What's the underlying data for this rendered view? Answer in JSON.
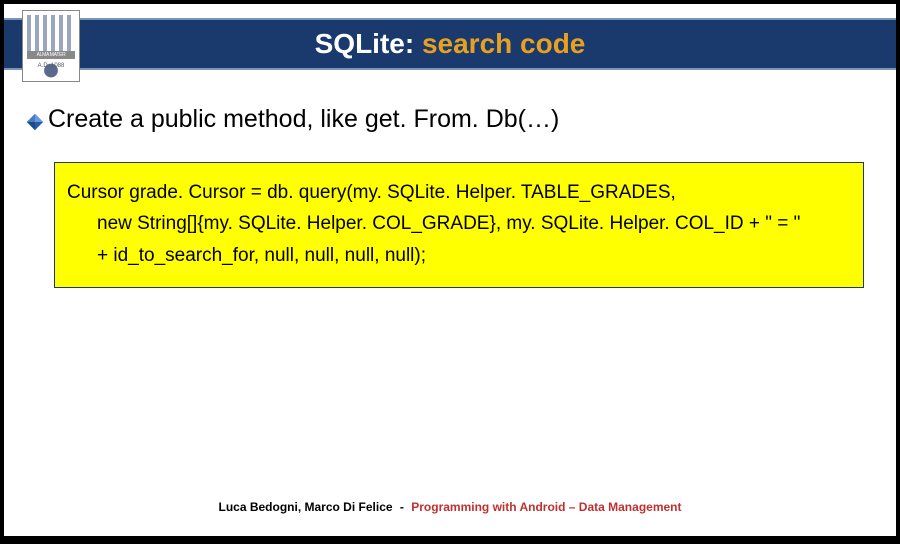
{
  "header": {
    "title_plain": "SQLite: ",
    "title_accent": "search code"
  },
  "logo": {
    "top_text": "ALMA MATER STUDIORUM",
    "bottom_text": "A.D. 1088"
  },
  "bullet": {
    "text": "Create a public method, like get. From. Db(…)"
  },
  "code": {
    "line1": "Cursor grade. Cursor = db. query(my. SQLite. Helper. TABLE_GRADES,",
    "line2": "new String[]{my. SQLite. Helper. COL_GRADE}, my. SQLite. Helper. COL_ID + \" = \"",
    "line3": "+ id_to_search_for, null, null, null, null);"
  },
  "footer": {
    "authors": "Luca Bedogni, Marco Di Felice",
    "separator": "-",
    "course": "Programming with Android – Data Management"
  }
}
